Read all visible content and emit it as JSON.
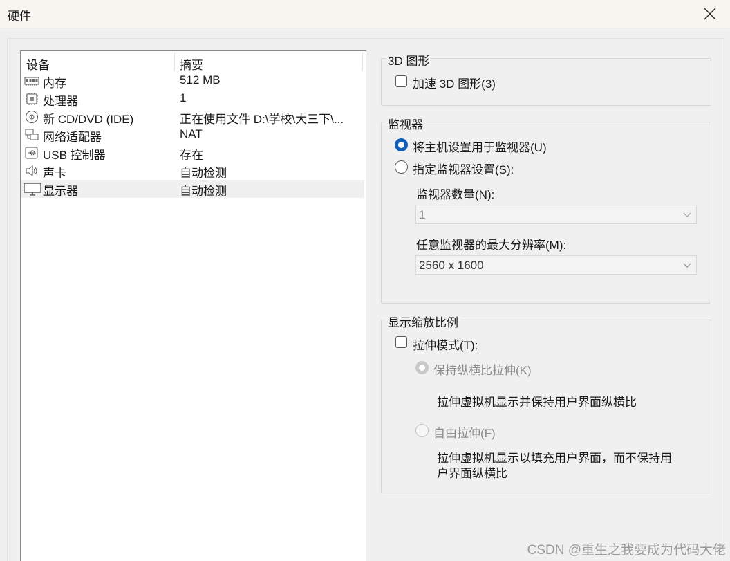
{
  "window": {
    "title": "硬件"
  },
  "device_list": {
    "headers": {
      "device": "设备",
      "summary": "摘要"
    },
    "rows": [
      {
        "icon": "memory-icon",
        "name": "内存",
        "summary": "512 MB",
        "selected": false
      },
      {
        "icon": "processor-icon",
        "name": "处理器",
        "summary": "1",
        "selected": false
      },
      {
        "icon": "cd-dvd-icon",
        "name": "新 CD/DVD (IDE)",
        "summary": "正在使用文件 D:\\学校\\大三下\\...",
        "selected": false
      },
      {
        "icon": "network-adapter-icon",
        "name": "网络适配器",
        "summary": "NAT",
        "selected": false
      },
      {
        "icon": "usb-icon",
        "name": "USB 控制器",
        "summary": "存在",
        "selected": false
      },
      {
        "icon": "speaker-icon",
        "name": "声卡",
        "summary": "自动检测",
        "selected": false
      },
      {
        "icon": "display-icon",
        "name": "显示器",
        "summary": "自动检测",
        "selected": true
      }
    ]
  },
  "graphics_3d": {
    "legend": "3D 图形",
    "accelerate_label": "加速 3D 图形(3)",
    "accelerate_checked": false
  },
  "monitors": {
    "legend": "监视器",
    "use_host_label": "将主机设置用于监视器(U)",
    "specify_label": "指定监视器设置(S):",
    "selected": "use_host",
    "count_label": "监视器数量(N):",
    "count_value": "1",
    "max_res_label": "任意监视器的最大分辨率(M):",
    "max_res_value": "2560 x 1600"
  },
  "scaling": {
    "legend": "显示缩放比例",
    "stretch_label": "拉伸模式(T):",
    "stretch_checked": false,
    "keep_aspect_label": "保持纵横比拉伸(K)",
    "keep_aspect_desc": "拉伸虚拟机显示并保持用户界面纵横比",
    "free_stretch_label": "自由拉伸(F)",
    "free_stretch_desc_1": "拉伸虚拟机显示以填充用户界面，而不保持用",
    "free_stretch_desc_2": "户界面纵横比"
  },
  "watermark": "CSDN @重生之我要成为代码大佬",
  "colors": {
    "accent": "#0f5fb6",
    "disabled_text": "#8a8a8a",
    "panel_border": "#828790"
  }
}
